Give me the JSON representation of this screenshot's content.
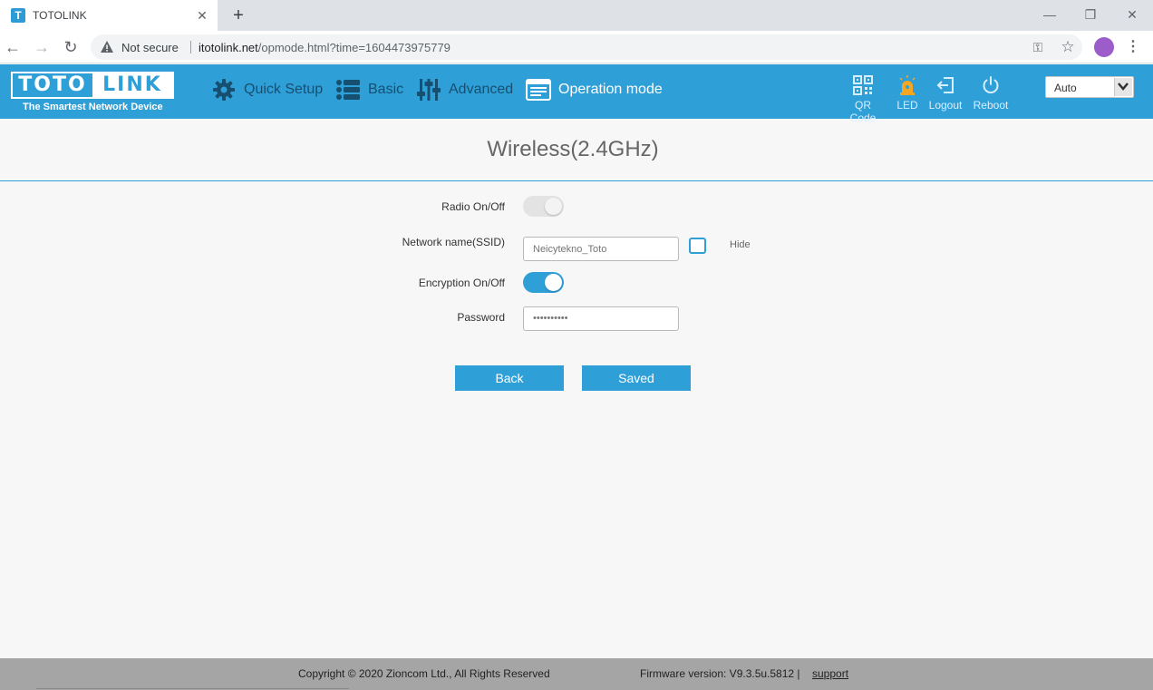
{
  "browser": {
    "tab_title": "TOTOLINK",
    "tab_favicon_letter": "T",
    "security_label": "Not secure",
    "url_host": "itotolink.net",
    "url_path": "/opmode.html?time=1604473975779"
  },
  "header": {
    "logo_left": "TOTO",
    "logo_right": "LINK",
    "tagline": "The Smartest Network Device",
    "nav": [
      {
        "label": "Quick Setup",
        "icon": "gear-icon"
      },
      {
        "label": "Basic",
        "icon": "list-icon"
      },
      {
        "label": "Advanced",
        "icon": "sliders-icon"
      },
      {
        "label": "Operation mode",
        "icon": "operation-mode-icon",
        "active": true
      }
    ],
    "tools": [
      {
        "label": "QR Code",
        "icon": "qr-code-icon"
      },
      {
        "label": "LED",
        "icon": "led-icon"
      },
      {
        "label": "Logout",
        "icon": "logout-icon"
      },
      {
        "label": "Reboot",
        "icon": "power-icon"
      }
    ],
    "language": "Auto"
  },
  "page": {
    "title": "Wireless(2.4GHz)",
    "radio_label": "Radio On/Off",
    "radio_enabled": false,
    "ssid_label": "Network name(SSID)",
    "ssid_placeholder": "Neicytekno_Toto",
    "hide_label": "Hide",
    "hide_checked": false,
    "encryption_label": "Encryption On/Off",
    "encryption_enabled": true,
    "password_label": "Password",
    "password_value": "••••••••••",
    "back_button": "Back",
    "save_button": "Saved"
  },
  "footer": {
    "copyright": "Copyright © 2020 Zioncom Ltd., All Rights Reserved",
    "firmware": "Firmware version: V9.3.5u.5812  |",
    "support": "support"
  },
  "colors": {
    "accent": "#2f9fd8",
    "header_nav_text": "#174f70",
    "led_icon": "#f5a623",
    "footer_bg": "#a5a5a5"
  }
}
